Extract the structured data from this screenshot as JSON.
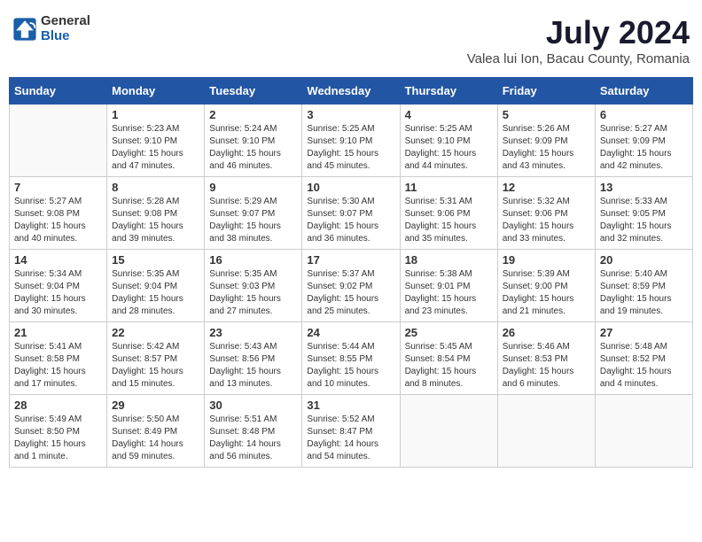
{
  "logo": {
    "general": "General",
    "blue": "Blue"
  },
  "title": "July 2024",
  "location": "Valea lui Ion, Bacau County, Romania",
  "weekdays": [
    "Sunday",
    "Monday",
    "Tuesday",
    "Wednesday",
    "Thursday",
    "Friday",
    "Saturday"
  ],
  "weeks": [
    [
      {
        "day": "",
        "info": ""
      },
      {
        "day": "1",
        "info": "Sunrise: 5:23 AM\nSunset: 9:10 PM\nDaylight: 15 hours\nand 47 minutes."
      },
      {
        "day": "2",
        "info": "Sunrise: 5:24 AM\nSunset: 9:10 PM\nDaylight: 15 hours\nand 46 minutes."
      },
      {
        "day": "3",
        "info": "Sunrise: 5:25 AM\nSunset: 9:10 PM\nDaylight: 15 hours\nand 45 minutes."
      },
      {
        "day": "4",
        "info": "Sunrise: 5:25 AM\nSunset: 9:10 PM\nDaylight: 15 hours\nand 44 minutes."
      },
      {
        "day": "5",
        "info": "Sunrise: 5:26 AM\nSunset: 9:09 PM\nDaylight: 15 hours\nand 43 minutes."
      },
      {
        "day": "6",
        "info": "Sunrise: 5:27 AM\nSunset: 9:09 PM\nDaylight: 15 hours\nand 42 minutes."
      }
    ],
    [
      {
        "day": "7",
        "info": "Sunrise: 5:27 AM\nSunset: 9:08 PM\nDaylight: 15 hours\nand 40 minutes."
      },
      {
        "day": "8",
        "info": "Sunrise: 5:28 AM\nSunset: 9:08 PM\nDaylight: 15 hours\nand 39 minutes."
      },
      {
        "day": "9",
        "info": "Sunrise: 5:29 AM\nSunset: 9:07 PM\nDaylight: 15 hours\nand 38 minutes."
      },
      {
        "day": "10",
        "info": "Sunrise: 5:30 AM\nSunset: 9:07 PM\nDaylight: 15 hours\nand 36 minutes."
      },
      {
        "day": "11",
        "info": "Sunrise: 5:31 AM\nSunset: 9:06 PM\nDaylight: 15 hours\nand 35 minutes."
      },
      {
        "day": "12",
        "info": "Sunrise: 5:32 AM\nSunset: 9:06 PM\nDaylight: 15 hours\nand 33 minutes."
      },
      {
        "day": "13",
        "info": "Sunrise: 5:33 AM\nSunset: 9:05 PM\nDaylight: 15 hours\nand 32 minutes."
      }
    ],
    [
      {
        "day": "14",
        "info": "Sunrise: 5:34 AM\nSunset: 9:04 PM\nDaylight: 15 hours\nand 30 minutes."
      },
      {
        "day": "15",
        "info": "Sunrise: 5:35 AM\nSunset: 9:04 PM\nDaylight: 15 hours\nand 28 minutes."
      },
      {
        "day": "16",
        "info": "Sunrise: 5:35 AM\nSunset: 9:03 PM\nDaylight: 15 hours\nand 27 minutes."
      },
      {
        "day": "17",
        "info": "Sunrise: 5:37 AM\nSunset: 9:02 PM\nDaylight: 15 hours\nand 25 minutes."
      },
      {
        "day": "18",
        "info": "Sunrise: 5:38 AM\nSunset: 9:01 PM\nDaylight: 15 hours\nand 23 minutes."
      },
      {
        "day": "19",
        "info": "Sunrise: 5:39 AM\nSunset: 9:00 PM\nDaylight: 15 hours\nand 21 minutes."
      },
      {
        "day": "20",
        "info": "Sunrise: 5:40 AM\nSunset: 8:59 PM\nDaylight: 15 hours\nand 19 minutes."
      }
    ],
    [
      {
        "day": "21",
        "info": "Sunrise: 5:41 AM\nSunset: 8:58 PM\nDaylight: 15 hours\nand 17 minutes."
      },
      {
        "day": "22",
        "info": "Sunrise: 5:42 AM\nSunset: 8:57 PM\nDaylight: 15 hours\nand 15 minutes."
      },
      {
        "day": "23",
        "info": "Sunrise: 5:43 AM\nSunset: 8:56 PM\nDaylight: 15 hours\nand 13 minutes."
      },
      {
        "day": "24",
        "info": "Sunrise: 5:44 AM\nSunset: 8:55 PM\nDaylight: 15 hours\nand 10 minutes."
      },
      {
        "day": "25",
        "info": "Sunrise: 5:45 AM\nSunset: 8:54 PM\nDaylight: 15 hours\nand 8 minutes."
      },
      {
        "day": "26",
        "info": "Sunrise: 5:46 AM\nSunset: 8:53 PM\nDaylight: 15 hours\nand 6 minutes."
      },
      {
        "day": "27",
        "info": "Sunrise: 5:48 AM\nSunset: 8:52 PM\nDaylight: 15 hours\nand 4 minutes."
      }
    ],
    [
      {
        "day": "28",
        "info": "Sunrise: 5:49 AM\nSunset: 8:50 PM\nDaylight: 15 hours\nand 1 minute."
      },
      {
        "day": "29",
        "info": "Sunrise: 5:50 AM\nSunset: 8:49 PM\nDaylight: 14 hours\nand 59 minutes."
      },
      {
        "day": "30",
        "info": "Sunrise: 5:51 AM\nSunset: 8:48 PM\nDaylight: 14 hours\nand 56 minutes."
      },
      {
        "day": "31",
        "info": "Sunrise: 5:52 AM\nSunset: 8:47 PM\nDaylight: 14 hours\nand 54 minutes."
      },
      {
        "day": "",
        "info": ""
      },
      {
        "day": "",
        "info": ""
      },
      {
        "day": "",
        "info": ""
      }
    ]
  ]
}
